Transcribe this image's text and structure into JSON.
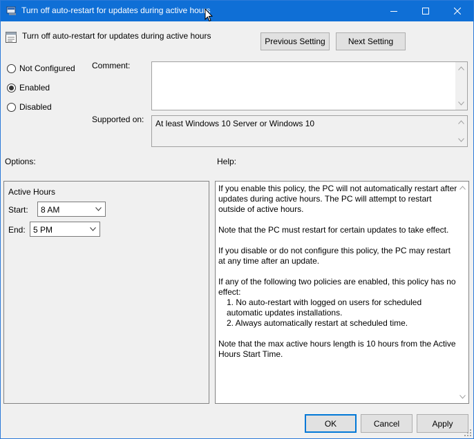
{
  "window": {
    "title": "Turn off auto-restart for updates during active hours"
  },
  "policy": {
    "name": "Turn off auto-restart for updates during active hours",
    "previous_label": "Previous Setting",
    "next_label": "Next Setting"
  },
  "state": {
    "options": [
      {
        "label": "Not Configured",
        "selected": false
      },
      {
        "label": "Enabled",
        "selected": true
      },
      {
        "label": "Disabled",
        "selected": false
      }
    ]
  },
  "comment": {
    "label": "Comment:",
    "value": ""
  },
  "supported": {
    "label": "Supported on:",
    "value": "At least Windows 10 Server or Windows 10"
  },
  "options_panel": {
    "label": "Options:",
    "heading": "Active Hours",
    "start_label": "Start:",
    "start_value": "8 AM",
    "end_label": "End:",
    "end_value": "5 PM"
  },
  "help": {
    "label": "Help:",
    "paragraphs": [
      "If you enable this policy, the PC will not automatically restart after updates during active hours. The PC will attempt to restart outside of active hours.",
      "Note that the PC must restart for certain updates to take effect.",
      "If you disable or do not configure this policy, the PC may restart at any time after an update."
    ],
    "list_intro": "If any of the following two policies are enabled, this policy has no effect:",
    "list_items": [
      "1. No auto-restart with logged on users for scheduled automatic updates installations.",
      "2. Always automatically restart at scheduled time."
    ],
    "closing": "Note that the max active hours length is 10 hours from the Active Hours Start Time."
  },
  "buttons": {
    "ok": "OK",
    "cancel": "Cancel",
    "apply": "Apply"
  },
  "colors": {
    "titlebar": "#0f6fd6",
    "default_button_border": "#0078d7",
    "window_bg": "#f0f0f0"
  }
}
